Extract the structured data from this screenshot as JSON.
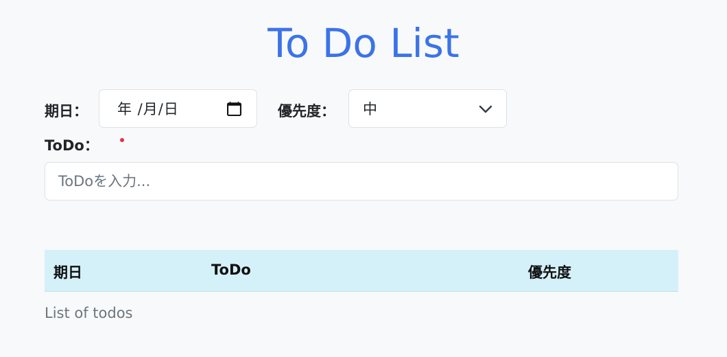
{
  "title": "To Do List",
  "form": {
    "date_label": "期日：",
    "date_value": "年 /月/日",
    "priority_label": "優先度：",
    "priority_value": "中",
    "todo_label": "ToDo：",
    "todo_placeholder": "ToDoを入力..."
  },
  "table": {
    "headers": [
      "期日",
      "ToDo",
      "優先度"
    ],
    "rows": [],
    "caption": "List of todos"
  },
  "colors": {
    "title": "#3b73e8",
    "header_bg": "#d4f1f9",
    "required": "#dc3545"
  },
  "icons": {
    "date": "calendar-icon",
    "select": "chevron-down-icon"
  }
}
